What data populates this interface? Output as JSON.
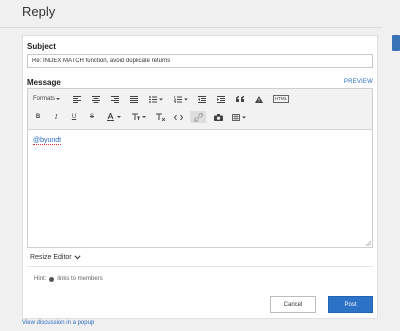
{
  "page": {
    "title": "Reply"
  },
  "subject": {
    "label": "Subject",
    "value": "Re: INDEX MATCH function, avoid duplicate returns"
  },
  "message": {
    "label": "Message",
    "preview_label": "PREVIEW",
    "content_mention": "@byundt"
  },
  "toolbar": {
    "formats_label": "Formats",
    "html_label": "HTML"
  },
  "resize": {
    "label": "Resize Editor"
  },
  "hint": {
    "prefix": "Hint:",
    "text": "links to members"
  },
  "buttons": {
    "cancel": "Cancel",
    "post": "Post"
  },
  "footer": {
    "popup_link": "View discussion in a popup"
  },
  "colors": {
    "accent": "#2c72c7",
    "link": "#2a6bbf"
  }
}
